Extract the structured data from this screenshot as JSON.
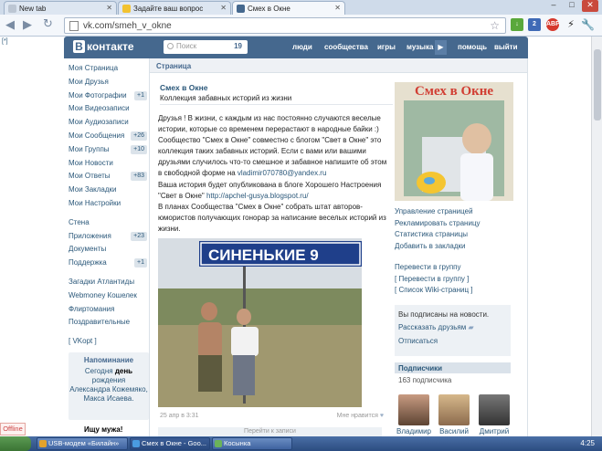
{
  "browser": {
    "tabs": [
      {
        "label": "New tab"
      },
      {
        "label": "Задайте ваш вопрос"
      },
      {
        "label": "Смех в Окне"
      }
    ],
    "url": "vk.com/smeh_v_okne"
  },
  "vk": {
    "logo": "контакте",
    "logo_mark": "B",
    "search_placeholder": "Поиск",
    "search_count": "19",
    "topnav": [
      "люди",
      "сообщества",
      "игры",
      "музыка",
      "помощь",
      "выйти"
    ],
    "bracket": "[*]",
    "left_menu": [
      {
        "label": "Моя Страница",
        "badge": ""
      },
      {
        "label": "Мои Друзья",
        "badge": ""
      },
      {
        "label": "Мои Фотографии",
        "badge": "+1"
      },
      {
        "label": "Мои Видеозаписи",
        "badge": ""
      },
      {
        "label": "Мои Аудиозаписи",
        "badge": ""
      },
      {
        "label": "Мои Сообщения",
        "badge": "+26"
      },
      {
        "label": "Мои Группы",
        "badge": "+10"
      },
      {
        "label": "Мои Новости",
        "badge": ""
      },
      {
        "label": "Мои Ответы",
        "badge": "+83"
      },
      {
        "label": "Мои Закладки",
        "badge": ""
      },
      {
        "label": "Мои Настройки",
        "badge": ""
      }
    ],
    "left_menu2": [
      {
        "label": "Стена",
        "badge": ""
      },
      {
        "label": "Приложения",
        "badge": "+23"
      },
      {
        "label": "Документы",
        "badge": ""
      },
      {
        "label": "Поддержка",
        "badge": "+1"
      }
    ],
    "left_menu3": [
      "Загадки Атлантиды",
      "Webmoney Кошелек",
      "Флиртомания",
      "Поздравительные"
    ],
    "vkopt": "[ VKopt ]",
    "birthday": {
      "title": "Напоминание",
      "line1": "Сегодня",
      "bold": "день",
      "line2": "рождения",
      "names": "Александра Кожемяко, Макса Исаева."
    },
    "offline": "Offline",
    "ishu": "Ищу мужа!"
  },
  "page": {
    "crumb": "Страница",
    "title": "Смех в Окне",
    "status": "Коллекция забавных историй из жизни",
    "desc_1": "Друзья ! В жизни, с каждым из нас постоянно случаются веселые истории, которые со временем перерастают в народные байки :) Сообщество \"Смех в Окне\" совместно с блогом \"Свет в Окне\" это коллекция таких забавных историй. Если с вами или вашими друзьями случилось что-то смешное и забавное напишите об этом в свободной форме на ",
    "email": "vladimir070780@yandex.ru",
    "desc_2": "Ваша история будет опубликована в блоге Хорошего Настроения \"Свет в Окне\" ",
    "blog": "http://apchel-gusya.blogspot.ru/",
    "desc_3": "В планах Сообщества \"Смех в Окне\" собрать штат авторов-юмористов получающих гонорар за написание веселых историй из жизни.",
    "photo_sign": "СИНЕНЬКИЕ  9",
    "post_date": "25 апр в 3:31",
    "likes": "Мне нравится",
    "more": "Перейти к записи",
    "cover_text": "Смех в Окне",
    "actions": [
      "Управление страницей",
      "Рекламировать страницу",
      "Статистика страницы",
      "Добавить в закладки"
    ],
    "group_links": [
      "Перевести в группу",
      "[ Перевести в группу ]",
      "[ Список Wiki-страниц ]"
    ],
    "sub": {
      "desc": "Вы подписаны на новости.",
      "tell": "Рассказать друзьям",
      "unsub": "Отписаться"
    },
    "subscribers": {
      "title": "Подписчики",
      "count": "163 подписчика",
      "people": [
        "Владимир",
        "Василий",
        "Дмитрий"
      ]
    }
  },
  "taskbar": {
    "items": [
      "USB-модем «Билайн»",
      "Смех в Окне - Goo...",
      "Косынка"
    ],
    "clock": "4:25"
  }
}
